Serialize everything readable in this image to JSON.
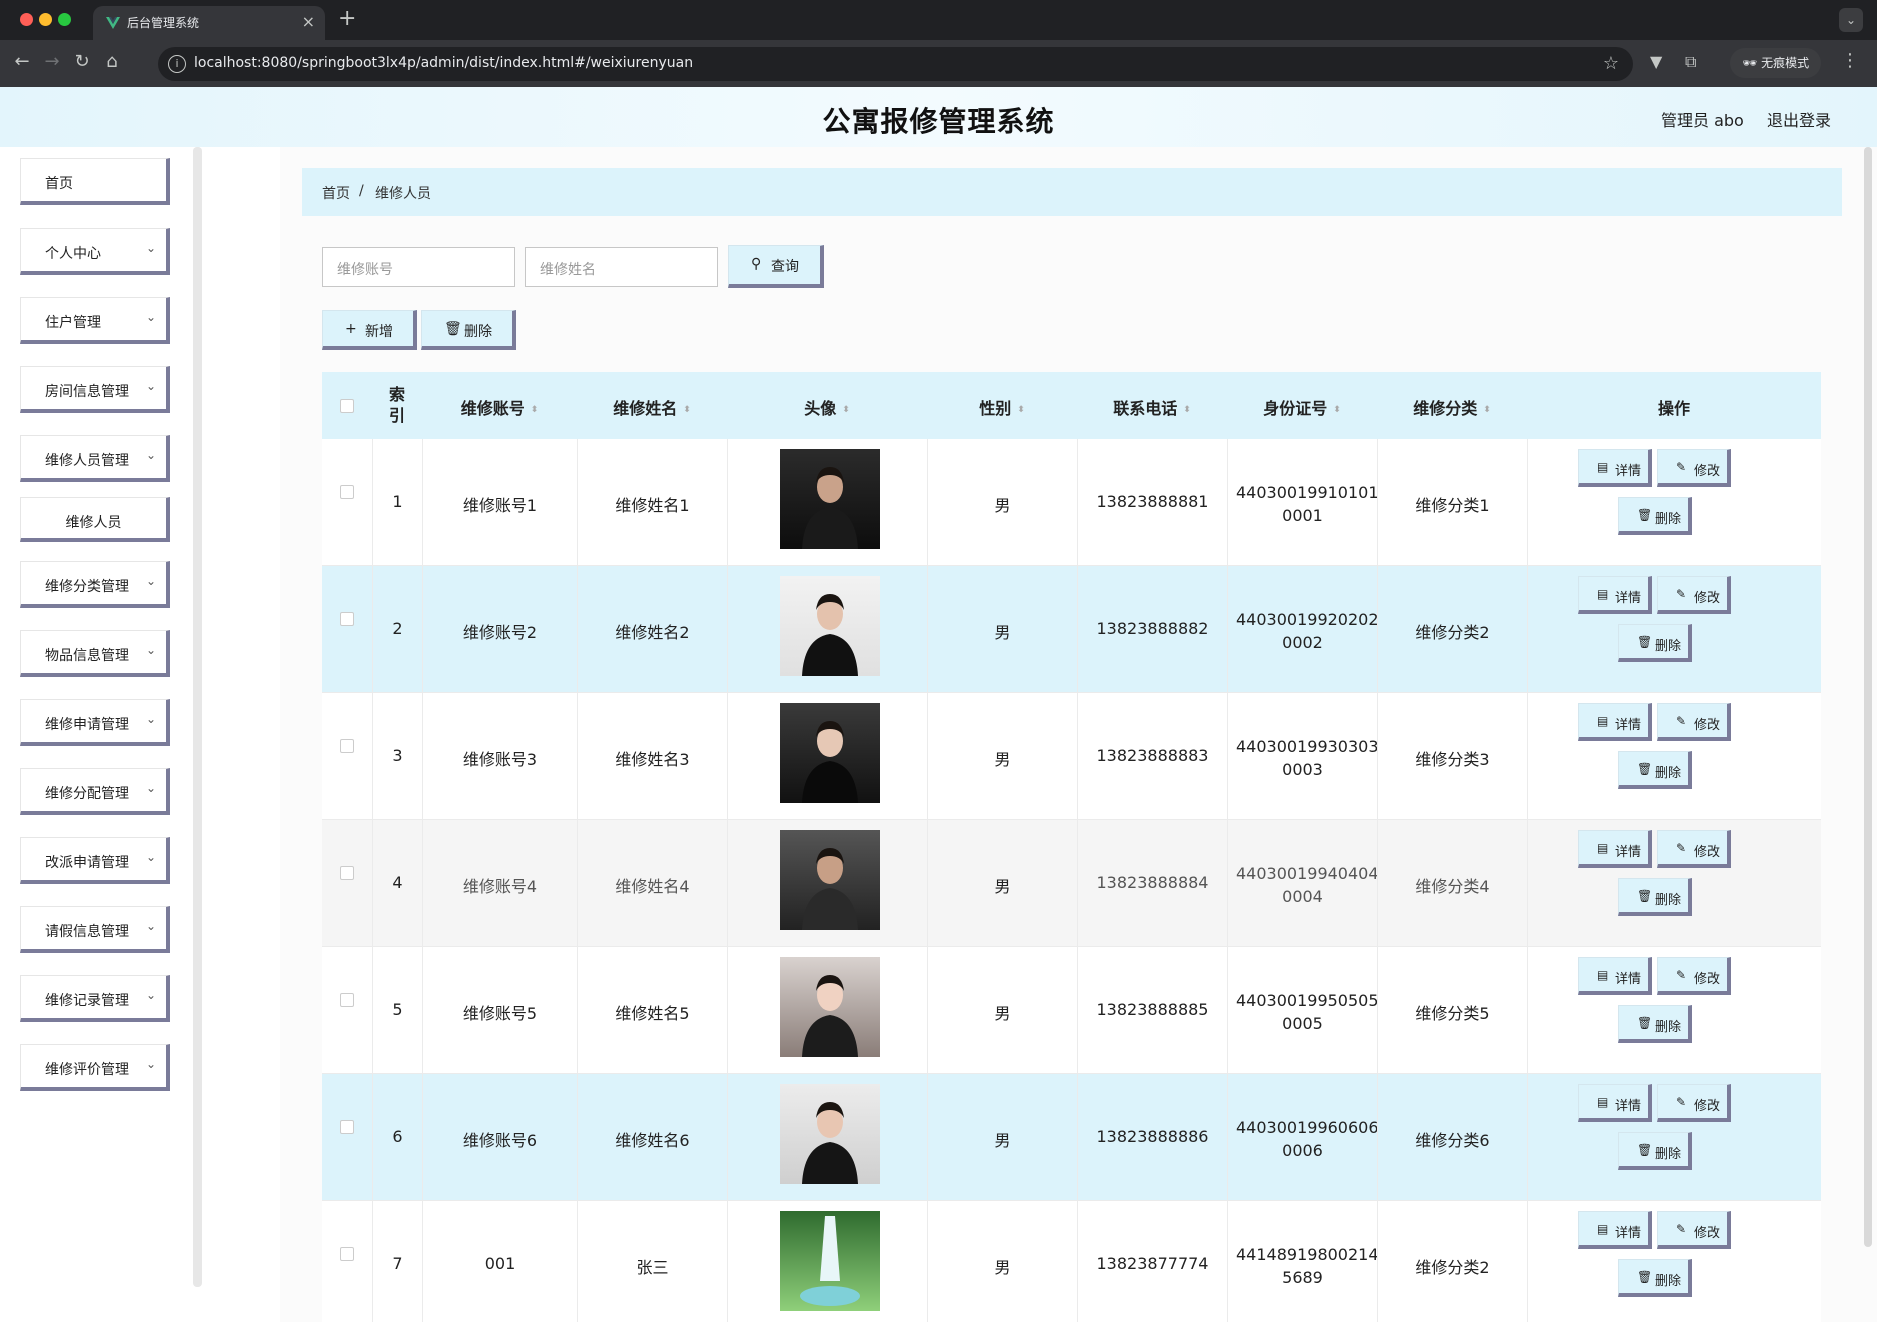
{
  "browser": {
    "tab_title": "后台管理系统",
    "url": "localhost:8080/springboot3lx4p/admin/dist/index.html#/weixiurenyuan",
    "incognito_label": "无痕模式",
    "colors": {
      "tabbar": "#202124",
      "toolbar": "#35363a",
      "close_dot": "#ff5f57",
      "min_dot": "#febc2e",
      "max_dot": "#28c840"
    }
  },
  "header": {
    "title": "公寓报修管理系统",
    "user": "管理员 abo",
    "logout": "退出登录"
  },
  "sidebar": {
    "items": [
      {
        "label": "首页",
        "has_arrow": false
      },
      {
        "label": "个人中心",
        "has_arrow": true
      },
      {
        "label": "住户管理",
        "has_arrow": true
      },
      {
        "label": "房间信息管理",
        "has_arrow": true
      },
      {
        "label": "维修人员管理",
        "has_arrow": true
      },
      {
        "label": "维修人员",
        "has_arrow": false,
        "sub": true
      },
      {
        "label": "维修分类管理",
        "has_arrow": true
      },
      {
        "label": "物品信息管理",
        "has_arrow": true
      },
      {
        "label": "维修申请管理",
        "has_arrow": true
      },
      {
        "label": "维修分配管理",
        "has_arrow": true
      },
      {
        "label": "改派申请管理",
        "has_arrow": true
      },
      {
        "label": "请假信息管理",
        "has_arrow": true
      },
      {
        "label": "维修记录管理",
        "has_arrow": true
      },
      {
        "label": "维修评价管理",
        "has_arrow": true
      }
    ]
  },
  "breadcrumb": {
    "home": "首页",
    "separator": "/",
    "current": "维修人员"
  },
  "search": {
    "account_placeholder": "维修账号",
    "name_placeholder": "维修姓名",
    "query_label": "查询"
  },
  "actions": {
    "add_label": "新增",
    "delete_label": "删除"
  },
  "table": {
    "columns": [
      "索引",
      "维修账号",
      "维修姓名",
      "头像",
      "性别",
      "联系电话",
      "身份证号",
      "维修分类",
      "操作"
    ],
    "ops": {
      "detail": "详情",
      "edit": "修改",
      "delete": "删除"
    },
    "rows": [
      {
        "index": "1",
        "account": "维修账号1",
        "name": "维修姓名1",
        "avatar": "man in dark suit",
        "gender": "男",
        "phone": "13823888881",
        "id_line1": "44030019910101",
        "id_line2": "0001",
        "category": "维修分类1",
        "highlight": false
      },
      {
        "index": "2",
        "account": "维修账号2",
        "name": "维修姓名2",
        "avatar": "woman in black suit",
        "gender": "男",
        "phone": "13823888882",
        "id_line1": "44030019920202",
        "id_line2": "0002",
        "category": "维修分类2",
        "highlight": true
      },
      {
        "index": "3",
        "account": "维修账号3",
        "name": "维修姓名3",
        "avatar": "woman in black dress",
        "gender": "男",
        "phone": "13823888883",
        "id_line1": "44030019930303",
        "id_line2": "0003",
        "category": "维修分类3",
        "highlight": false
      },
      {
        "index": "4",
        "account": "维修账号4",
        "name": "维修姓名4",
        "avatar": "man seated in suit",
        "gender": "男",
        "phone": "13823888884",
        "id_line1": "44030019940404",
        "id_line2": "0004",
        "category": "维修分类4",
        "highlight": false,
        "hover": true
      },
      {
        "index": "5",
        "account": "维修账号5",
        "name": "维修姓名5",
        "avatar": "woman portrait",
        "gender": "男",
        "phone": "13823888885",
        "id_line1": "44030019950505",
        "id_line2": "0005",
        "category": "维修分类5",
        "highlight": false
      },
      {
        "index": "6",
        "account": "维修账号6",
        "name": "维修姓名6",
        "avatar": "woman in black suit",
        "gender": "男",
        "phone": "13823888886",
        "id_line1": "44030019960606",
        "id_line2": "0006",
        "category": "维修分类6",
        "highlight": true
      },
      {
        "index": "7",
        "account": "001",
        "name": "张三",
        "avatar": "green waterfall",
        "gender": "男",
        "phone": "13823877774",
        "id_line1": "44148919800214",
        "id_line2": "5689",
        "category": "维修分类2",
        "highlight": false
      }
    ]
  },
  "colors": {
    "accent": "#dcf3fb",
    "button_shadow": "#7a7b99",
    "row_hover": "#f5f5f5"
  }
}
